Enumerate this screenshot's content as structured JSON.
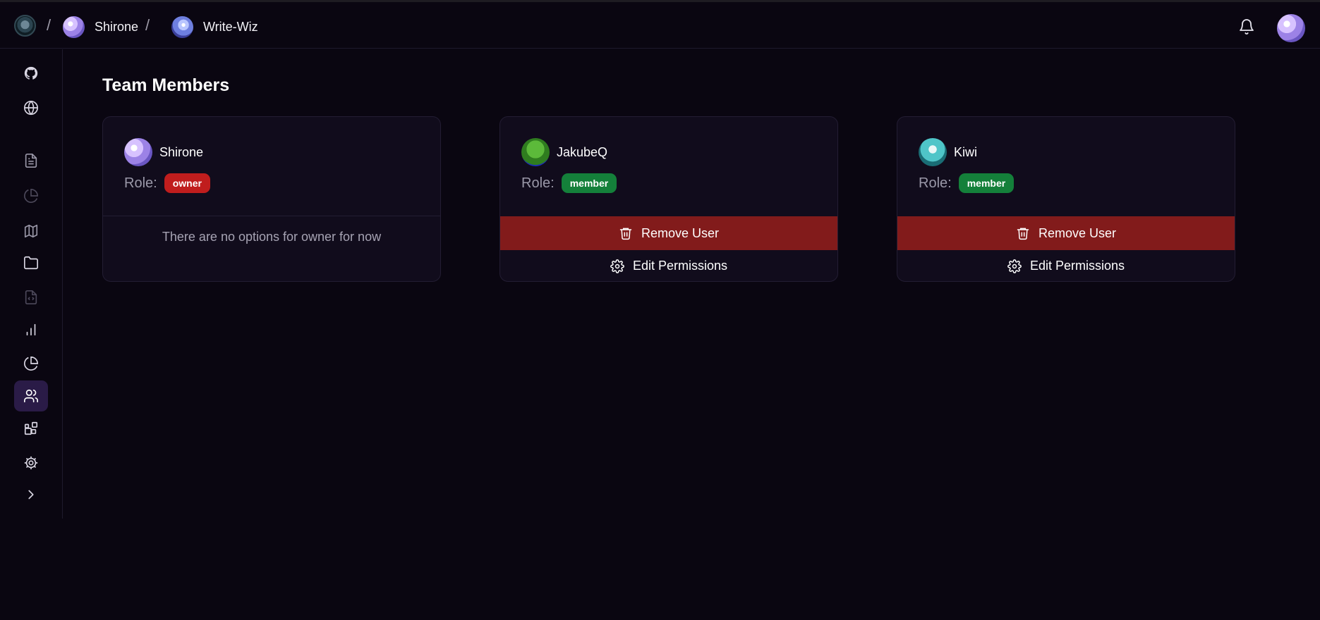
{
  "breadcrumb": {
    "org": "Shirone",
    "project": "Write-Wiz",
    "separator": "/"
  },
  "sidebar": {
    "items": [
      {
        "icon": "github-icon",
        "active": false
      },
      {
        "icon": "globe-icon",
        "active": false
      },
      {
        "icon": "document-icon",
        "active": false
      },
      {
        "icon": "pie-chart-outline-icon",
        "active": false
      },
      {
        "icon": "map-icon",
        "active": false
      },
      {
        "icon": "folder-icon",
        "active": false
      },
      {
        "icon": "code-file-icon",
        "active": false
      },
      {
        "icon": "bar-chart-icon",
        "active": false
      },
      {
        "icon": "pie-chart-icon",
        "active": false
      },
      {
        "icon": "users-icon",
        "active": true
      },
      {
        "icon": "widgets-icon",
        "active": false
      },
      {
        "icon": "gear-icon",
        "active": false
      },
      {
        "icon": "chevron-right-icon",
        "active": false
      }
    ]
  },
  "page": {
    "title": "Team Members"
  },
  "members": [
    {
      "name": "Shirone",
      "role_label": "Role:",
      "role": "owner",
      "no_options_text": "There are no options for owner for now"
    },
    {
      "name": "JakubeQ",
      "role_label": "Role:",
      "role": "member",
      "remove_label": "Remove User",
      "edit_label": "Edit Permissions"
    },
    {
      "name": "Kiwi",
      "role_label": "Role:",
      "role": "member",
      "remove_label": "Remove User",
      "edit_label": "Edit Permissions"
    }
  ],
  "colors": {
    "background": "#0a0611",
    "card": "#110c1c",
    "owner_badge": "#c01d1d",
    "member_badge": "#14803a",
    "remove_button": "#821b1b",
    "active_nav": "#2a1b47"
  }
}
